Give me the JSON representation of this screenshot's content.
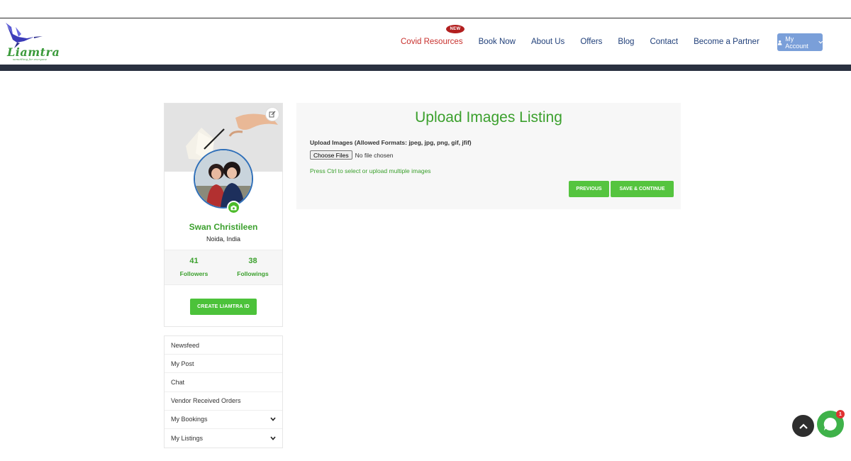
{
  "header": {
    "logo_text": "Liamtra",
    "logo_tagline": "something for everyone",
    "nav": [
      {
        "label": "Covid Resources",
        "badge": "NEW"
      },
      {
        "label": "Book Now"
      },
      {
        "label": "About Us"
      },
      {
        "label": "Offers"
      },
      {
        "label": "Blog"
      },
      {
        "label": "Contact"
      },
      {
        "label": "Become a Partner"
      }
    ],
    "account_label": "My Account",
    "account_icon": "user-icon"
  },
  "profile": {
    "name": "Swan Christileen",
    "location": "Noida, India",
    "followers_count": "41",
    "followers_label": "Followers",
    "followings_count": "38",
    "followings_label": "Followings",
    "create_button": "CREATE LIAMTRA ID"
  },
  "side_menu": {
    "items": [
      {
        "label": "Newsfeed"
      },
      {
        "label": "My Post"
      },
      {
        "label": "Chat"
      },
      {
        "label": "Vendor Received Orders"
      },
      {
        "label": "My Bookings",
        "expandable": true
      },
      {
        "label": "My Listings",
        "expandable": true
      }
    ]
  },
  "main": {
    "title": "Upload Images Listing",
    "upload_label": "Upload Images (Allowed Formats: jpeg, jpg, png, gif, jfif)",
    "choose_files": "Choose Files",
    "no_file": "No file chosen",
    "hint": "Press Ctrl to select or upload multiple images",
    "previous_button": "PREVIOUS",
    "save_button": "SAVE & CONTINUE"
  },
  "floating": {
    "chat_badge": "1"
  },
  "colors": {
    "brand_green": "#3ba02d",
    "button_green": "#55c43f",
    "nav_blue": "#21407a",
    "covid_red": "#c8302d",
    "account_blue": "#7a9fd9",
    "header_bar": "#2a3140"
  }
}
